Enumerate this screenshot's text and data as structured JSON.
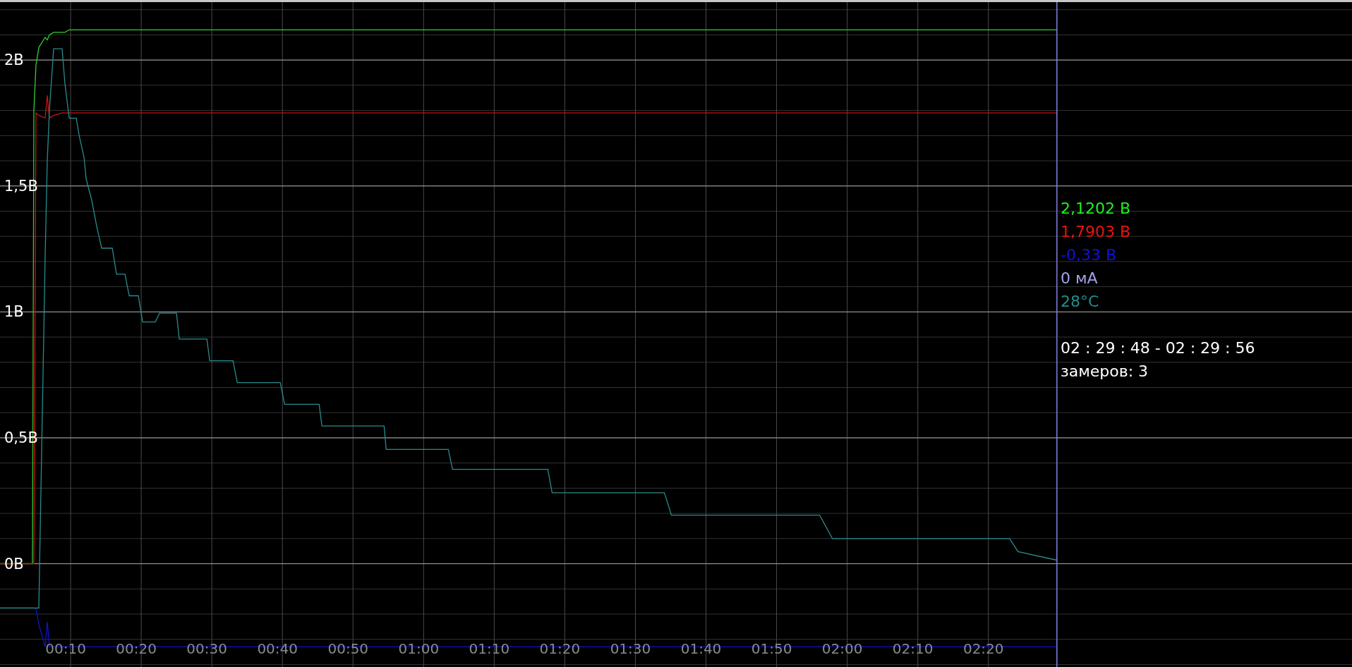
{
  "chart": {
    "chart_data": {
      "type": "line",
      "x": [
        0,
        4.6,
        4.8,
        5.1,
        5.5,
        6.4,
        6.7,
        7.0,
        7.6,
        8.8,
        9.2,
        9.8,
        10.8,
        11.2,
        11.9,
        12.2,
        13,
        13.7,
        14.4,
        15.9,
        16.5,
        17.7,
        18.3,
        19.6,
        20.2,
        22,
        22.6,
        25,
        25.4,
        29.3,
        29.7,
        33,
        33.6,
        39.7,
        40.3,
        45.2,
        45.6,
        54.4,
        54.7,
        63.5,
        64.1,
        77.6,
        78.2,
        94.1,
        95.1,
        116.1,
        117.9,
        143,
        144.2,
        149.7
      ],
      "series": [
        {
          "color": "#33cc33",
          "values": [
            0,
            0,
            1.8,
            1.98,
            2.05,
            2.09,
            2.08,
            2.1,
            2.11,
            2.11,
            2.11,
            2.12,
            2.12,
            2.12,
            2.12,
            2.12,
            2.12,
            2.12,
            2.12,
            2.12,
            2.12,
            2.12,
            2.12,
            2.12,
            2.12,
            2.12,
            2.12,
            2.12,
            2.12,
            2.12,
            2.12,
            2.12,
            2.12,
            2.12,
            2.12,
            2.12,
            2.12,
            2.12,
            2.12,
            2.12,
            2.12,
            2.12,
            2.12,
            2.12,
            2.12,
            2.12,
            2.12,
            2.12,
            2.12,
            2.12
          ]
        },
        {
          "color": "#cc1111",
          "values": [
            0,
            0,
            0,
            1.79,
            1.78,
            1.77,
            1.86,
            1.77,
            1.78,
            1.79,
            1.79,
            1.79,
            1.79,
            1.79,
            1.79,
            1.79,
            1.79,
            1.79,
            1.79,
            1.79,
            1.79,
            1.79,
            1.79,
            1.79,
            1.79,
            1.79,
            1.79,
            1.79,
            1.79,
            1.79,
            1.79,
            1.79,
            1.79,
            1.79,
            1.79,
            1.79,
            1.79,
            1.79,
            1.79,
            1.79,
            1.79,
            1.79,
            1.79,
            1.79,
            1.79,
            1.79,
            1.79,
            1.79,
            1.79,
            1.79
          ]
        },
        {
          "color": "#1212c8",
          "values": [
            -0.175,
            -0.175,
            -0.175,
            -0.18,
            -0.24,
            -0.33,
            -0.23,
            -0.33,
            -0.33,
            -0.33,
            -0.33,
            -0.33,
            -0.33,
            -0.33,
            -0.33,
            -0.33,
            -0.33,
            -0.33,
            -0.33,
            -0.33,
            -0.33,
            -0.33,
            -0.33,
            -0.33,
            -0.33,
            -0.33,
            -0.33,
            -0.33,
            -0.33,
            -0.33,
            -0.33,
            -0.33,
            -0.33,
            -0.33,
            -0.33,
            -0.33,
            -0.33,
            -0.33,
            -0.33,
            -0.33,
            -0.33,
            -0.33,
            -0.33,
            -0.33,
            -0.33,
            -0.33,
            -0.33,
            -0.33,
            -0.33,
            -0.33
          ]
        },
        {
          "color": "#2a8c8c",
          "values": [
            -0.176,
            -0.176,
            -0.176,
            -0.176,
            -0.176,
            1.22,
            1.6,
            1.8,
            2.045,
            2.045,
            1.907,
            1.769,
            1.769,
            1.701,
            1.614,
            1.528,
            1.442,
            1.339,
            1.253,
            1.253,
            1.15,
            1.15,
            1.064,
            1.064,
            0.96,
            0.96,
            0.995,
            0.995,
            0.892,
            0.892,
            0.806,
            0.806,
            0.719,
            0.719,
            0.633,
            0.633,
            0.547,
            0.547,
            0.454,
            0.454,
            0.375,
            0.375,
            0.282,
            0.282,
            0.193,
            0.193,
            0.1,
            0.1,
            0.048,
            0.014
          ]
        }
      ],
      "xlim": [
        0,
        191.5
      ],
      "ylim": [
        -0.41,
        2.23
      ],
      "xticks": [
        {
          "value": 10,
          "label": "00:10"
        },
        {
          "value": 20,
          "label": "00:20"
        },
        {
          "value": 30,
          "label": "00:30"
        },
        {
          "value": 40,
          "label": "00:40"
        },
        {
          "value": 50,
          "label": "00:50"
        },
        {
          "value": 60,
          "label": "01:00"
        },
        {
          "value": 70,
          "label": "01:10"
        },
        {
          "value": 80,
          "label": "01:20"
        },
        {
          "value": 90,
          "label": "01:30"
        },
        {
          "value": 100,
          "label": "01:40"
        },
        {
          "value": 110,
          "label": "01:50"
        },
        {
          "value": 120,
          "label": "02:00"
        },
        {
          "value": 130,
          "label": "02:10"
        },
        {
          "value": 140,
          "label": "02:20"
        }
      ],
      "yticks": [
        {
          "value": 0,
          "label": "0В"
        },
        {
          "value": 0.5,
          "label": "0,5В"
        },
        {
          "value": 1,
          "label": "1В"
        },
        {
          "value": 1.5,
          "label": "1,5В"
        },
        {
          "value": 2,
          "label": "2В"
        }
      ],
      "grid": true,
      "ref_lines": [
        {
          "axis": "x",
          "value": 149.7,
          "color": "#8080e0"
        }
      ]
    }
  },
  "readings": [
    {
      "text": "2,1202 В",
      "color": "#22ee22"
    },
    {
      "text": "1,7903 В",
      "color": "#ee1111"
    },
    {
      "text": "-0,33 В",
      "color": "#1111dd"
    },
    {
      "text": "0 мА",
      "color": "#a0a0ea"
    },
    {
      "text": "28°C",
      "color": "#1e8f8f"
    }
  ],
  "interval": "02 : 29 : 48 - 02 : 29 : 56",
  "samples": "замеров: 3"
}
